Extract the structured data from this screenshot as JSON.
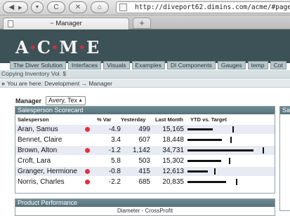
{
  "browser": {
    "url": "http://diveport62.dimins.com/acme/#page=a0045",
    "tab_title": "~ Manager",
    "new_tab_label": "+",
    "back_icon": "back-arrow-icon",
    "forward_icon": "forward-arrow-icon"
  },
  "app": {
    "logo_letters": [
      "A",
      "C",
      "M",
      "E"
    ],
    "logo_separator": "•",
    "nav": [
      "The Diver Solution",
      "Interfaces",
      "Visuals",
      "Examples",
      "DI Components",
      "Gauges",
      "temp",
      "Cot"
    ],
    "subheader": "Copying Inventory Vol. $",
    "breadcrumb_arrow": "»",
    "breadcrumb": "You are here:  Development → Manager"
  },
  "manager": {
    "label": "Manager",
    "selected": "Avery, Tex"
  },
  "scorecard": {
    "title": "Salesperson Scorecard",
    "columns": [
      "Salesperson",
      "% Var",
      "Yesterday",
      "Last Month",
      "YTD vs. Target"
    ],
    "rows": [
      {
        "name": "Aran, Samus",
        "status": "red",
        "var": "-4.9",
        "yesterday": "499",
        "last_month": "15,165",
        "ytd": 0.31,
        "target": 0.56
      },
      {
        "name": "Bennet, Claire",
        "status": "none",
        "var": "3.4",
        "yesterday": "607",
        "last_month": "18,448",
        "ytd": 0.43,
        "target": 0.53
      },
      {
        "name": "Brown, Alton",
        "status": "red",
        "var": "-1.2",
        "yesterday": "1,142",
        "last_month": "34,731",
        "ytd": 0.82,
        "target": 0.93
      },
      {
        "name": "Croft, Lara",
        "status": "none",
        "var": "5.8",
        "yesterday": "503",
        "last_month": "15,302",
        "ytd": 0.42,
        "target": 0.51
      },
      {
        "name": "Granger, Hermione",
        "status": "red",
        "var": "-0.8",
        "yesterday": "415",
        "last_month": "12,613",
        "ytd": 0.25,
        "target": 0.33
      },
      {
        "name": "Norris, Charles",
        "status": "red",
        "var": "-2.2",
        "yesterday": "685",
        "last_month": "20,835",
        "ytd": 0.48,
        "target": 0.6
      }
    ],
    "status_colors": {
      "red": "#e0313c"
    }
  },
  "side_panel": {
    "title": "Sa"
  },
  "product": {
    "title": "Product Performance",
    "subtitle": "Diameter - CrossProfit"
  }
}
